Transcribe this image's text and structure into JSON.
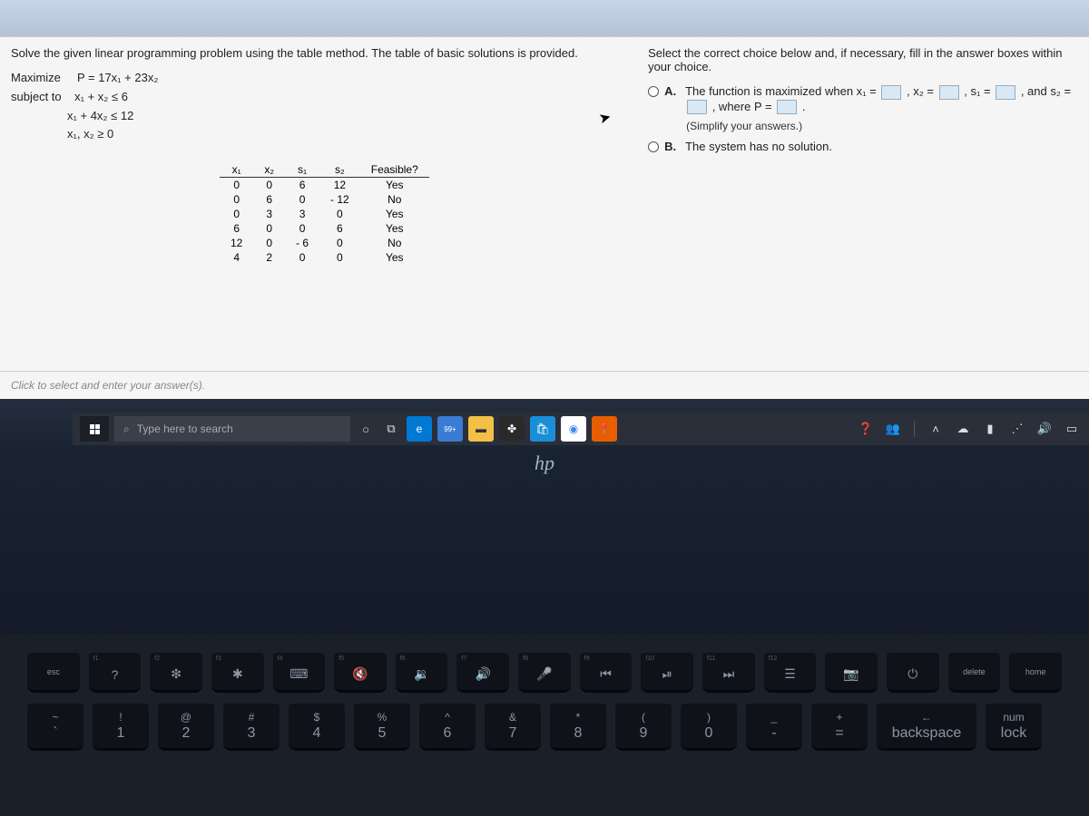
{
  "question": {
    "left_instruction": "Solve the given linear programming problem using the table method. The table of basic solutions is provided.",
    "objective_label": "Maximize",
    "objective": "P = 17x₁ + 23x₂",
    "subject_label": "subject to",
    "constraints": [
      "x₁ + x₂ ≤ 6",
      "x₁ + 4x₂ ≤ 12",
      "x₁, x₂ ≥ 0"
    ],
    "right_instruction": "Select the correct choice below and, if necessary, fill in the answer boxes within your choice.",
    "choice_A": {
      "label": "A.",
      "pre1": "The function is maximized when x₁ =",
      "sep1": ", x₂ =",
      "sep2": ", s₁ =",
      "sep3": ", and s₂ =",
      "sep4": ", where P =",
      "tail": ".",
      "simplify": "(Simplify your answers.)"
    },
    "choice_B": {
      "label": "B.",
      "text": "The system has no solution."
    },
    "hint_text": "Click to select and enter your answer(s)."
  },
  "table": {
    "headers": [
      "x₁",
      "x₂",
      "s₁",
      "s₂",
      "Feasible?"
    ],
    "rows": [
      [
        "0",
        "0",
        "6",
        "12",
        "Yes"
      ],
      [
        "0",
        "6",
        "0",
        "- 12",
        "No"
      ],
      [
        "0",
        "3",
        "3",
        "0",
        "Yes"
      ],
      [
        "6",
        "0",
        "0",
        "6",
        "Yes"
      ],
      [
        "12",
        "0",
        "- 6",
        "0",
        "No"
      ],
      [
        "4",
        "2",
        "0",
        "0",
        "Yes"
      ]
    ]
  },
  "taskbar": {
    "search_placeholder": "Type here to search",
    "weather_badge": "99+"
  },
  "laptop_brand": "hp",
  "keyboard": {
    "fn_row": [
      {
        "label": "esc",
        "glyph": "",
        "fn": ""
      },
      {
        "label": "",
        "glyph": "?",
        "fn": "f1"
      },
      {
        "label": "",
        "glyph": "❇",
        "fn": "f2"
      },
      {
        "label": "",
        "glyph": "✱",
        "fn": "f3"
      },
      {
        "label": "",
        "glyph": "⌨",
        "fn": "f4"
      },
      {
        "label": "",
        "glyph": "🔇",
        "fn": "f5"
      },
      {
        "label": "",
        "glyph": "🔉",
        "fn": "f6"
      },
      {
        "label": "",
        "glyph": "🔊",
        "fn": "f7"
      },
      {
        "label": "",
        "glyph": "🎤",
        "fn": "f8"
      },
      {
        "label": "",
        "glyph": "⏮",
        "fn": "f9"
      },
      {
        "label": "",
        "glyph": "⏯",
        "fn": "f10"
      },
      {
        "label": "",
        "glyph": "⏭",
        "fn": "f11"
      },
      {
        "label": "",
        "glyph": "☰",
        "fn": "f12"
      },
      {
        "label": "",
        "glyph": "📷",
        "fn": ""
      },
      {
        "label": "",
        "glyph": "⏻",
        "fn": ""
      },
      {
        "label": "delete",
        "glyph": "",
        "fn": ""
      },
      {
        "label": "home",
        "glyph": "",
        "fn": ""
      }
    ],
    "num_row": [
      {
        "top": "~",
        "bot": "`"
      },
      {
        "top": "!",
        "bot": "1"
      },
      {
        "top": "@",
        "bot": "2"
      },
      {
        "top": "#",
        "bot": "3"
      },
      {
        "top": "$",
        "bot": "4"
      },
      {
        "top": "%",
        "bot": "5"
      },
      {
        "top": "^",
        "bot": "6"
      },
      {
        "top": "&",
        "bot": "7"
      },
      {
        "top": "*",
        "bot": "8"
      },
      {
        "top": "(",
        "bot": "9"
      },
      {
        "top": ")",
        "bot": "0"
      },
      {
        "top": "_",
        "bot": "-"
      },
      {
        "top": "+",
        "bot": "="
      },
      {
        "top": "←",
        "bot": "backspace"
      },
      {
        "top": "num",
        "bot": "lock"
      }
    ]
  }
}
